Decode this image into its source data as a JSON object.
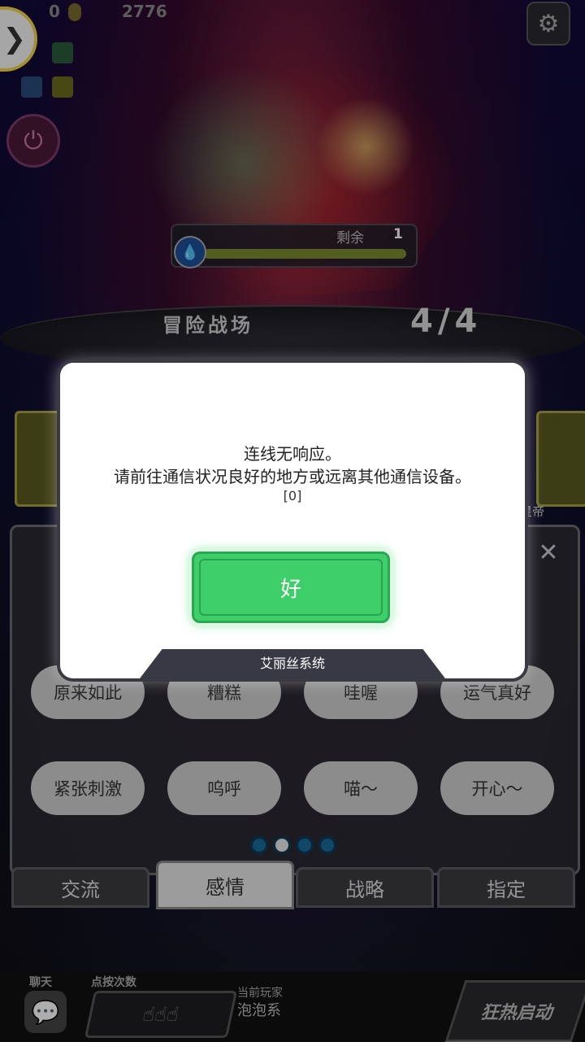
{
  "hud": {
    "coins": "0",
    "score": "2776"
  },
  "boss": {
    "remaining_label": "剩余",
    "remaining_count": "1"
  },
  "arena": {
    "title": "冒险战场",
    "stage_number": "4/4"
  },
  "party": {
    "right_name": "星帝"
  },
  "chat_panel": {
    "phrases_row1": [
      "原来如此",
      "糟糕",
      "哇喔",
      "运气真好"
    ],
    "phrases_row2": [
      "紧张刺激",
      "呜呼",
      "喵～",
      "开心～"
    ],
    "page_dots": 4,
    "active_page": 2,
    "tabs": [
      "交流",
      "感情",
      "战略",
      "指定"
    ],
    "active_tab": "感情"
  },
  "bottom_bar": {
    "chat_label": "聊天",
    "tap_count_label": "点按次数",
    "current_player_label": "当前玩家",
    "current_player_name": "泡泡系",
    "fever_label": "狂热启动"
  },
  "dialog": {
    "line1": "连线无响应。",
    "line2": "请前往通信状况良好的地方或远离其他通信设备。",
    "code": "[0]",
    "ok_label": "好",
    "footer": "艾丽丝系统"
  },
  "colors": {
    "ok_green": "#3ecf6a",
    "dialog_footer": "#393946"
  }
}
